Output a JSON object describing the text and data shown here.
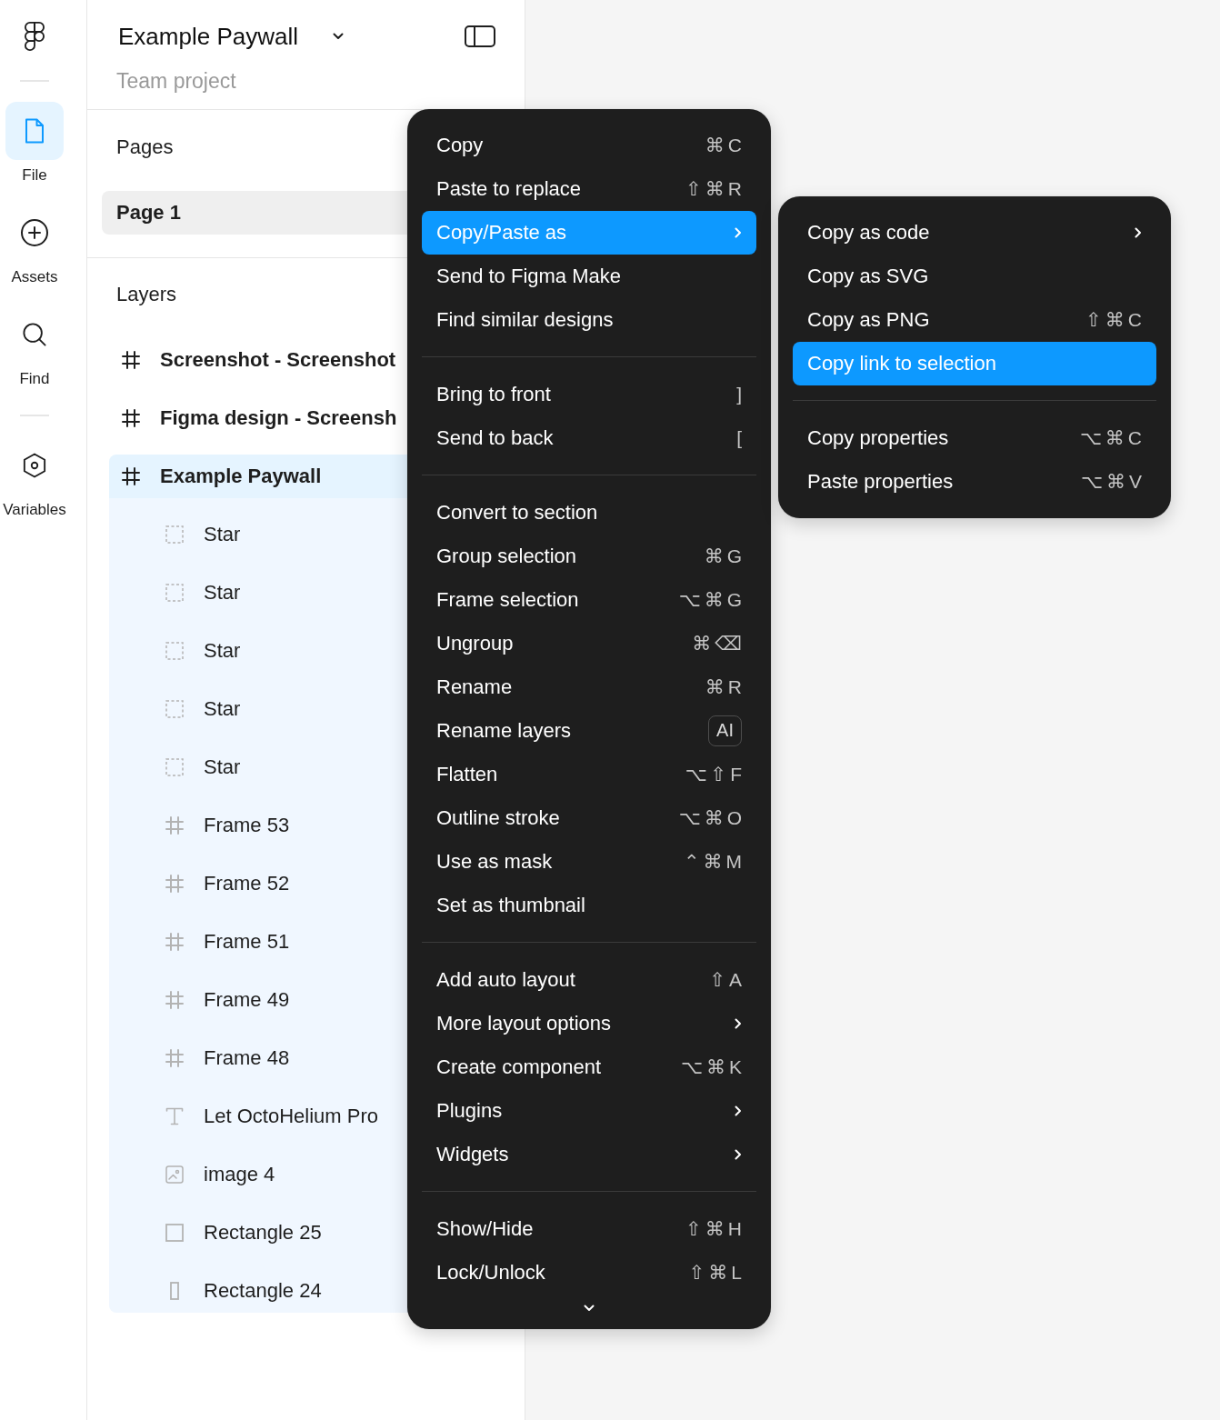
{
  "rail": {
    "groups": [
      {
        "items": [
          {
            "kind": "file",
            "label": "File",
            "selected": true
          },
          {
            "kind": "assets",
            "label": "Assets",
            "selected": false
          },
          {
            "kind": "find",
            "label": "Find",
            "selected": false
          }
        ]
      },
      {
        "items": [
          {
            "kind": "variables",
            "label": "Variables",
            "selected": false
          }
        ]
      }
    ]
  },
  "file": {
    "title": "Example Paywall",
    "subtitle": "Team project"
  },
  "pages": {
    "heading": "Pages",
    "items": [
      {
        "label": "Page 1",
        "selected": true
      }
    ]
  },
  "layers": {
    "heading": "Layers",
    "items": [
      {
        "kind": "frame",
        "label": "Screenshot - Screenshot",
        "selected": false
      },
      {
        "kind": "frame",
        "label": "Figma design - Screensh",
        "selected": false
      },
      {
        "kind": "frame",
        "label": "Example Paywall",
        "selected": true,
        "children": [
          {
            "kind": "star",
            "label": "Star",
            "selected": false
          },
          {
            "kind": "star",
            "label": "Star",
            "selected": false
          },
          {
            "kind": "star",
            "label": "Star",
            "selected": false
          },
          {
            "kind": "star",
            "label": "Star",
            "selected": false
          },
          {
            "kind": "star",
            "label": "Star",
            "selected": false
          },
          {
            "kind": "frame",
            "label": "Frame 53",
            "selected": false
          },
          {
            "kind": "frame",
            "label": "Frame 52",
            "selected": false
          },
          {
            "kind": "frame",
            "label": "Frame 51",
            "selected": false
          },
          {
            "kind": "frame",
            "label": "Frame 49",
            "selected": false
          },
          {
            "kind": "frame",
            "label": "Frame 48",
            "selected": false
          },
          {
            "kind": "text",
            "label": "Let OctoHelium Pro",
            "selected": false
          },
          {
            "kind": "image",
            "label": "image 4",
            "selected": false
          },
          {
            "kind": "rectangle",
            "label": "Rectangle 25",
            "selected": false
          },
          {
            "kind": "tall",
            "label": "Rectangle 24",
            "selected": false
          }
        ]
      }
    ]
  },
  "context_menu": {
    "sections": [
      {
        "items": [
          {
            "label": "Copy",
            "kind": "shortcut",
            "shortcut": "⌘C",
            "selected": false
          },
          {
            "label": "Paste to replace",
            "kind": "shortcut",
            "shortcut": "⇧⌘R",
            "selected": false
          },
          {
            "label": "Copy/Paste as",
            "kind": "submenu",
            "selected": true
          },
          {
            "label": "Send to Figma Make",
            "kind": "plain",
            "selected": false
          },
          {
            "label": "Find similar designs",
            "kind": "plain",
            "selected": false
          }
        ]
      },
      {
        "items": [
          {
            "label": "Bring to front",
            "kind": "shortcut",
            "shortcut": "]",
            "selected": false
          },
          {
            "label": "Send to back",
            "kind": "shortcut",
            "shortcut": "[",
            "selected": false
          }
        ]
      },
      {
        "items": [
          {
            "label": "Convert to section",
            "kind": "plain",
            "selected": false
          },
          {
            "label": "Group selection",
            "kind": "shortcut",
            "shortcut": "⌘G",
            "selected": false
          },
          {
            "label": "Frame selection",
            "kind": "shortcut",
            "shortcut": "⌥⌘G",
            "selected": false
          },
          {
            "label": "Ungroup",
            "kind": "shortcut",
            "shortcut": "⌘⌫",
            "selected": false
          },
          {
            "label": "Rename",
            "kind": "shortcut",
            "shortcut": "⌘R",
            "selected": false
          },
          {
            "label": "Rename layers",
            "kind": "badge",
            "badge": "AI",
            "selected": false
          },
          {
            "label": "Flatten",
            "kind": "shortcut",
            "shortcut": "⌥⇧F",
            "selected": false
          },
          {
            "label": "Outline stroke",
            "kind": "shortcut",
            "shortcut": "⌥⌘O",
            "selected": false
          },
          {
            "label": "Use as mask",
            "kind": "shortcut",
            "shortcut": "⌃⌘M",
            "selected": false
          },
          {
            "label": "Set as thumbnail",
            "kind": "plain",
            "selected": false
          }
        ]
      },
      {
        "items": [
          {
            "label": "Add auto layout",
            "kind": "shortcut",
            "shortcut": "⇧A",
            "selected": false
          },
          {
            "label": "More layout options",
            "kind": "submenu",
            "selected": false
          },
          {
            "label": "Create component",
            "kind": "shortcut",
            "shortcut": "⌥⌘K",
            "selected": false
          },
          {
            "label": "Plugins",
            "kind": "submenu",
            "selected": false
          },
          {
            "label": "Widgets",
            "kind": "submenu",
            "selected": false
          }
        ]
      },
      {
        "items": [
          {
            "label": "Show/Hide",
            "kind": "shortcut",
            "shortcut": "⇧⌘H",
            "selected": false
          },
          {
            "label": "Lock/Unlock",
            "kind": "shortcut",
            "shortcut": "⇧⌘L",
            "selected": false
          }
        ]
      }
    ]
  },
  "submenu": {
    "sections": [
      {
        "items": [
          {
            "label": "Copy as code",
            "kind": "submenu",
            "selected": false
          },
          {
            "label": "Copy as SVG",
            "kind": "plain",
            "selected": false
          },
          {
            "label": "Copy as PNG",
            "kind": "shortcut",
            "shortcut": "⇧⌘C",
            "selected": false
          },
          {
            "label": "Copy link to selection",
            "kind": "plain",
            "selected": true
          }
        ]
      },
      {
        "items": [
          {
            "label": "Copy properties",
            "kind": "shortcut",
            "shortcut": "⌥⌘C",
            "selected": false
          },
          {
            "label": "Paste properties",
            "kind": "shortcut",
            "shortcut": "⌥⌘V",
            "selected": false
          }
        ]
      }
    ]
  }
}
